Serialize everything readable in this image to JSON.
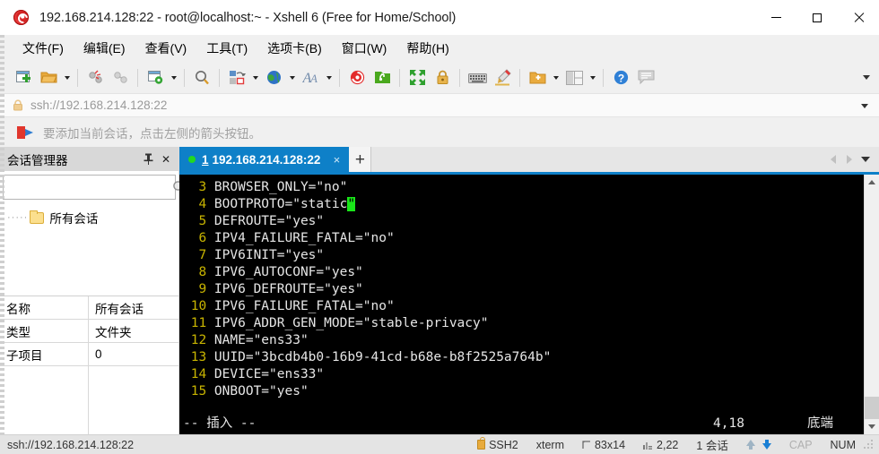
{
  "window": {
    "title": "192.168.214.128:22 - root@localhost:~ - Xshell 6 (Free for Home/School)",
    "logo_icon": "xshell-logo-icon",
    "minimize_label": "—",
    "maximize_label": "□",
    "close_label": "✕"
  },
  "menubar": {
    "items": [
      {
        "label": "文件(F)",
        "name": "menu-file"
      },
      {
        "label": "编辑(E)",
        "name": "menu-edit"
      },
      {
        "label": "查看(V)",
        "name": "menu-view"
      },
      {
        "label": "工具(T)",
        "name": "menu-tools"
      },
      {
        "label": "选项卡(B)",
        "name": "menu-tabs"
      },
      {
        "label": "窗口(W)",
        "name": "menu-window"
      },
      {
        "label": "帮助(H)",
        "name": "menu-help"
      }
    ]
  },
  "toolbar": {
    "items": [
      "new-session-icon",
      "open-folder-icon",
      "separator",
      "disconnect-icon",
      "reconnect-icon",
      "separator",
      "session-properties-icon",
      "separator",
      "find-icon",
      "separator",
      "transfer-icon",
      "globe-icon",
      "font-icon",
      "separator",
      "xshell-icon",
      "xftp-icon",
      "separator",
      "fullscreen-icon",
      "lock-icon",
      "separator",
      "keyboard-icon",
      "highlight-icon",
      "separator",
      "add-folder-icon",
      "layout-icon",
      "separator",
      "help-icon",
      "comment-icon"
    ],
    "overflow_icon": "toolbar-overflow-icon"
  },
  "address_bar": {
    "lock_icon": "address-lock-icon",
    "value": "ssh://192.168.214.128:22",
    "dropdown_icon": "address-dropdown-icon"
  },
  "notice_bar": {
    "icon": "add-session-arrow-icon",
    "text": "要添加当前会话，点击左侧的箭头按钮。"
  },
  "session_manager": {
    "title": "会话管理器",
    "pin_icon": "pin-icon",
    "close_icon": "close-icon",
    "search": {
      "value": "",
      "placeholder": "",
      "icon": "search-icon"
    },
    "tree": [
      {
        "label": "所有会话",
        "icon": "folder-icon"
      }
    ],
    "properties": [
      {
        "key": "名称",
        "value": "所有会话"
      },
      {
        "key": "类型",
        "value": "文件夹"
      },
      {
        "key": "子项目",
        "value": "0"
      }
    ]
  },
  "tabs": {
    "items": [
      {
        "number": "1",
        "label": "192.168.214.128:22",
        "status": "connected",
        "close_label": "×"
      }
    ],
    "new_tab_label": "+",
    "nav_prev_icon": "tab-prev-icon",
    "nav_next_icon": "tab-next-icon",
    "nav_menu_icon": "tab-list-icon"
  },
  "terminal": {
    "lines": [
      {
        "num": "3",
        "text": "BROWSER_ONLY=\"no\""
      },
      {
        "num": "4",
        "text": "BOOTPROTO=\"static",
        "cursor": "\""
      },
      {
        "num": "5",
        "text": "DEFROUTE=\"yes\""
      },
      {
        "num": "6",
        "text": "IPV4_FAILURE_FATAL=\"no\""
      },
      {
        "num": "7",
        "text": "IPV6INIT=\"yes\""
      },
      {
        "num": "8",
        "text": "IPV6_AUTOCONF=\"yes\""
      },
      {
        "num": "9",
        "text": "IPV6_DEFROUTE=\"yes\""
      },
      {
        "num": "10",
        "text": "IPV6_FAILURE_FATAL=\"no\""
      },
      {
        "num": "11",
        "text": "IPV6_ADDR_GEN_MODE=\"stable-privacy\""
      },
      {
        "num": "12",
        "text": "NAME=\"ens33\""
      },
      {
        "num": "13",
        "text": "UUID=\"3bcdb4b0-16b9-41cd-b68e-b8f2525a764b\""
      },
      {
        "num": "14",
        "text": "DEVICE=\"ens33\""
      },
      {
        "num": "15",
        "text": "ONBOOT=\"yes\""
      }
    ],
    "vim_status": {
      "mode": "-- 插入 --",
      "position": "4,18",
      "scroll": "底端"
    },
    "colors": {
      "background": "#000000",
      "foreground": "#e6e6e6",
      "line_number": "#c8b400",
      "cursor": "#19e619"
    }
  },
  "scrollbar": {
    "up_icon": "scroll-up-icon",
    "down_icon": "scroll-down-icon"
  },
  "status_bar": {
    "url": "ssh://192.168.214.128:22",
    "lock_icon": "status-lock-icon",
    "protocol": "SSH2",
    "terminal_type": "xterm",
    "size_icon": "terminal-size-icon",
    "size": "83x14",
    "cursor_icon": "cursor-pos-icon",
    "cursor": "2,22",
    "sessions": "1 会话",
    "upload_icon": "upload-arrow-icon",
    "download_icon": "download-arrow-icon",
    "caps": "CAP",
    "num": "NUM",
    "grip_icon": "resize-grip-icon"
  },
  "colors": {
    "accent": "#0e80c8",
    "titlebar_bg": "#ffffff",
    "chrome_bg": "#f0f0f0",
    "terminal_bg": "#000000",
    "status_bg": "#e4e4e4"
  }
}
